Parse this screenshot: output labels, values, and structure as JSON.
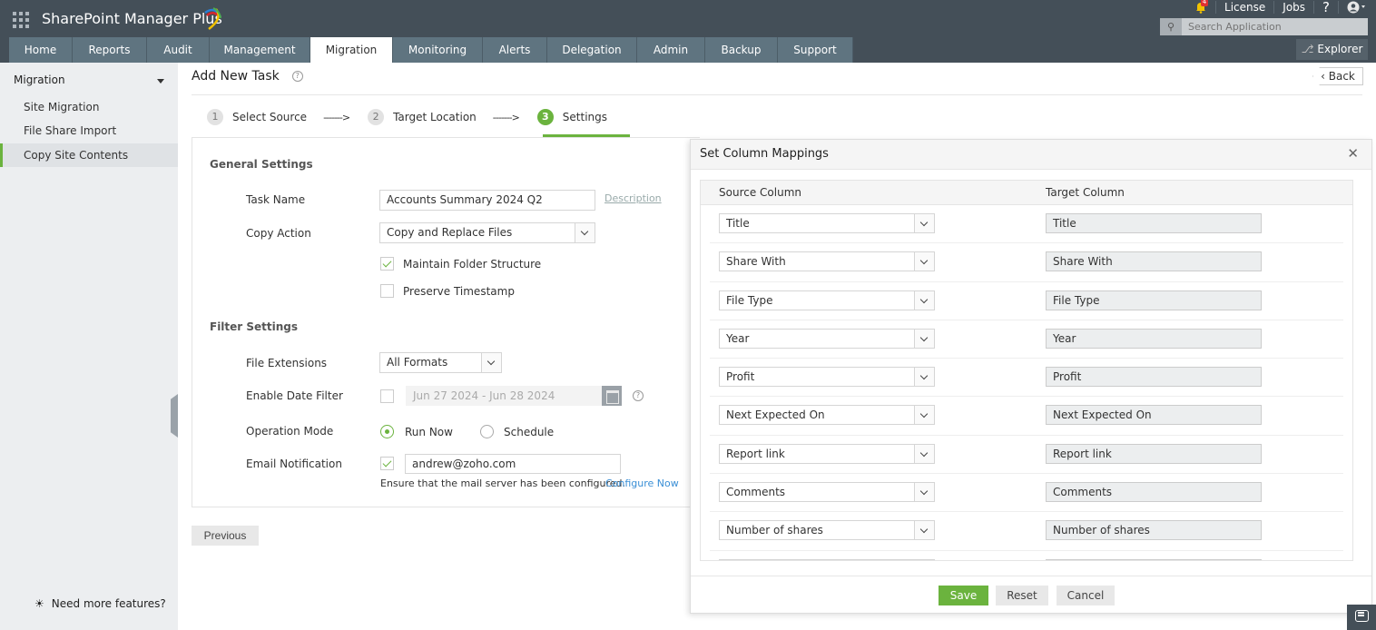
{
  "app": {
    "title": "SharePoint Manager Plus",
    "notifications_count": "4",
    "top_links": [
      "License",
      "Jobs",
      "?"
    ],
    "search_placeholder": "Search Application",
    "explorer_label": "Explorer"
  },
  "tabs": [
    {
      "label": "Home",
      "active": false
    },
    {
      "label": "Reports",
      "active": false
    },
    {
      "label": "Audit",
      "active": false
    },
    {
      "label": "Management",
      "active": false
    },
    {
      "label": "Migration",
      "active": true
    },
    {
      "label": "Monitoring",
      "active": false
    },
    {
      "label": "Alerts",
      "active": false
    },
    {
      "label": "Delegation",
      "active": false
    },
    {
      "label": "Admin",
      "active": false
    },
    {
      "label": "Backup",
      "active": false
    },
    {
      "label": "Support",
      "active": false
    }
  ],
  "sidebar": {
    "heading": "Migration",
    "items": [
      {
        "label": "Site Migration",
        "active": false
      },
      {
        "label": "File Share Import",
        "active": false
      },
      {
        "label": "Copy Site Contents",
        "active": true
      }
    ],
    "footer": "Need more features?"
  },
  "page": {
    "title": "Add New Task",
    "back_label": "Back",
    "steps": [
      {
        "num": "1",
        "label": "Select Source",
        "active": false
      },
      {
        "num": "2",
        "label": "Target Location",
        "active": false
      },
      {
        "num": "3",
        "label": "Settings",
        "active": true
      }
    ],
    "step_arrow": "------->"
  },
  "form": {
    "general_title": "General Settings",
    "task_name_label": "Task Name",
    "task_name_value": "Accounts Summary 2024 Q2",
    "description_link": "Description",
    "copy_action_label": "Copy Action",
    "copy_action_value": "Copy and Replace Files",
    "maintain_folder_label": "Maintain Folder Structure",
    "maintain_folder_checked": true,
    "preserve_timestamp_label": "Preserve Timestamp",
    "preserve_timestamp_checked": false,
    "filter_title": "Filter Settings",
    "file_ext_label": "File Extensions",
    "file_ext_value": "All Formats",
    "date_filter_label": "Enable Date Filter",
    "date_filter_checked": false,
    "date_range": "Jun 27 2024 - Jun 28 2024",
    "op_mode_label": "Operation Mode",
    "op_mode_options": [
      "Run Now",
      "Schedule"
    ],
    "op_mode_selected": "Run Now",
    "email_label": "Email Notification",
    "email_checked": true,
    "email_value": "andrew@zoho.com",
    "mail_note": "Ensure that the mail server has been configured.",
    "configure_link": "Configure Now",
    "previous_label": "Previous"
  },
  "dialog": {
    "title": "Set Column Mappings",
    "source_header": "Source Column",
    "target_header": "Target Column",
    "rows": [
      {
        "source": "Title",
        "target": "Title"
      },
      {
        "source": "Share With",
        "target": "Share With"
      },
      {
        "source": "File Type",
        "target": "File Type"
      },
      {
        "source": "Year",
        "target": "Year"
      },
      {
        "source": "Profit",
        "target": "Profit"
      },
      {
        "source": "Next Expected On",
        "target": "Next Expected On"
      },
      {
        "source": "Report link",
        "target": "Report link"
      },
      {
        "source": "Comments",
        "target": "Comments"
      },
      {
        "source": "Number of shares",
        "target": "Number of shares"
      },
      {
        "source": "",
        "target": ""
      }
    ],
    "save_label": "Save",
    "reset_label": "Reset",
    "cancel_label": "Cancel"
  },
  "colors": {
    "header_bg": "#444f58",
    "tab_bg": "#5f7480",
    "accent_green": "#6bb33e",
    "link_blue": "#3a8fd6"
  }
}
